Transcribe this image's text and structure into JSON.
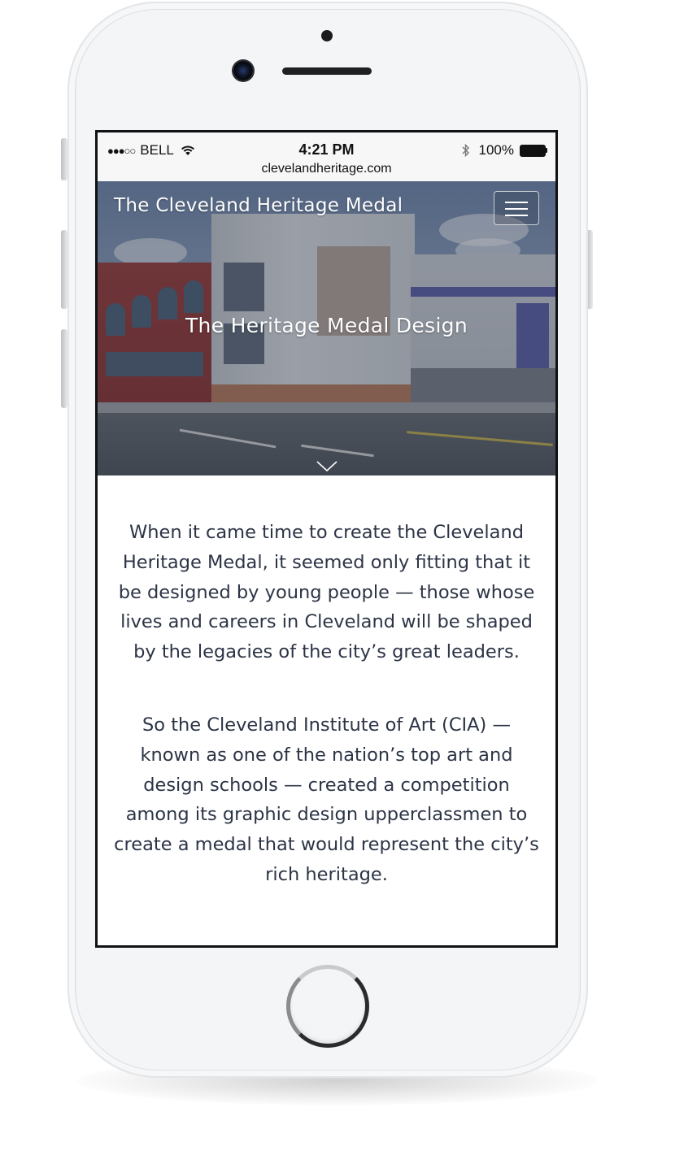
{
  "status_bar": {
    "signal": "●●●○○",
    "carrier": "BELL",
    "time": "4:21 PM",
    "battery": "100%",
    "url": "clevelandheritage.com"
  },
  "header": {
    "site_title": "The Cleveland Heritage Medal",
    "menu_icon": "hamburger-menu-icon"
  },
  "hero": {
    "heading": "The Heritage Medal Design",
    "scroll_icon": "chevron-down-icon"
  },
  "content": {
    "paragraphs": [
      "When it came time to create the Cleveland Heritage Medal, it seemed only fitting that it be designed by young people — those whose lives and careers in Cleveland will be shaped by the legacies of the city’s great leaders.",
      "So the Cleveland Institute of Art (CIA) — known as one of the nation’s top art and design schools — created a competition among its graphic design upperclassmen to create a medal that would represent the city’s rich heritage."
    ]
  },
  "colors": {
    "text": "#2c3446",
    "hero_overlay": "#28303e",
    "phone_body": "#f4f5f7",
    "screen_border": "#111214"
  }
}
